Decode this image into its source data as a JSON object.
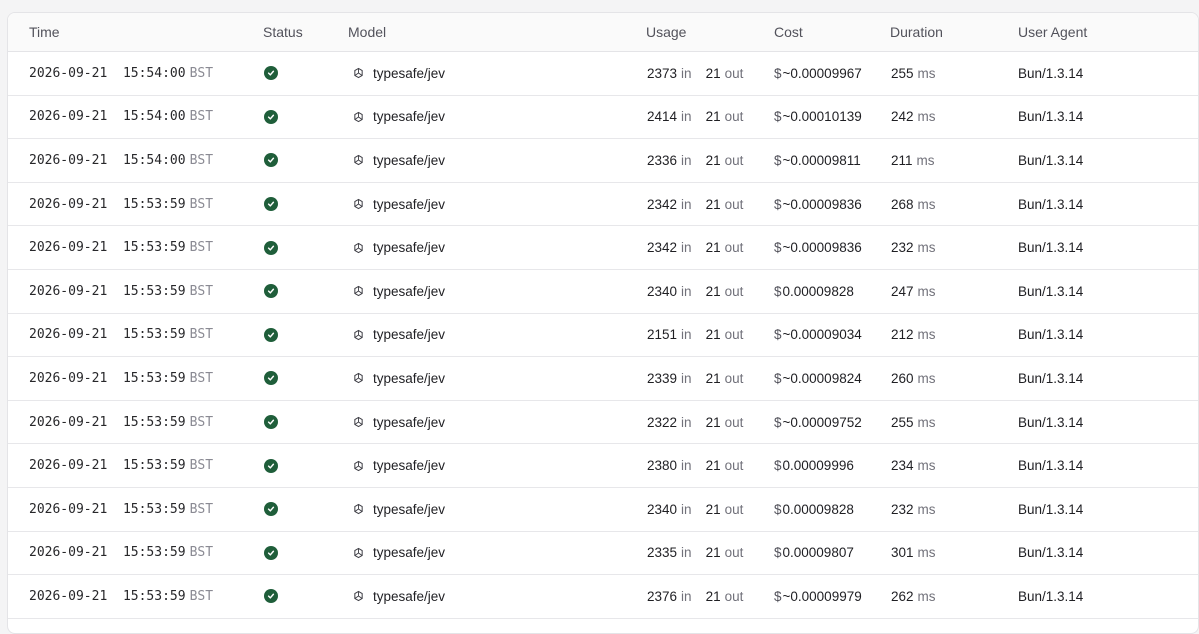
{
  "header": {
    "time": "Time",
    "status": "Status",
    "model": "Model",
    "usage": "Usage",
    "cost": "Cost",
    "duration": "Duration",
    "user_agent": "User Agent"
  },
  "labels": {
    "in": "in",
    "out": "out",
    "ms": "ms",
    "currency": "$"
  },
  "colors": {
    "status_ok": "#1f5e3a"
  },
  "rows": [
    {
      "date": "2026-09-21",
      "time": "15:54:00",
      "tz": "BST",
      "model": "typesafe/jev",
      "in": "2373",
      "out": "21",
      "cost": "~0.00009967",
      "duration": "255",
      "ua": "Bun/1.3.14"
    },
    {
      "date": "2026-09-21",
      "time": "15:54:00",
      "tz": "BST",
      "model": "typesafe/jev",
      "in": "2414",
      "out": "21",
      "cost": "~0.00010139",
      "duration": "242",
      "ua": "Bun/1.3.14"
    },
    {
      "date": "2026-09-21",
      "time": "15:54:00",
      "tz": "BST",
      "model": "typesafe/jev",
      "in": "2336",
      "out": "21",
      "cost": "~0.00009811",
      "duration": "211",
      "ua": "Bun/1.3.14"
    },
    {
      "date": "2026-09-21",
      "time": "15:53:59",
      "tz": "BST",
      "model": "typesafe/jev",
      "in": "2342",
      "out": "21",
      "cost": "~0.00009836",
      "duration": "268",
      "ua": "Bun/1.3.14"
    },
    {
      "date": "2026-09-21",
      "time": "15:53:59",
      "tz": "BST",
      "model": "typesafe/jev",
      "in": "2342",
      "out": "21",
      "cost": "~0.00009836",
      "duration": "232",
      "ua": "Bun/1.3.14"
    },
    {
      "date": "2026-09-21",
      "time": "15:53:59",
      "tz": "BST",
      "model": "typesafe/jev",
      "in": "2340",
      "out": "21",
      "cost": "0.00009828",
      "duration": "247",
      "ua": "Bun/1.3.14"
    },
    {
      "date": "2026-09-21",
      "time": "15:53:59",
      "tz": "BST",
      "model": "typesafe/jev",
      "in": "2151",
      "out": "21",
      "cost": "~0.00009034",
      "duration": "212",
      "ua": "Bun/1.3.14"
    },
    {
      "date": "2026-09-21",
      "time": "15:53:59",
      "tz": "BST",
      "model": "typesafe/jev",
      "in": "2339",
      "out": "21",
      "cost": "~0.00009824",
      "duration": "260",
      "ua": "Bun/1.3.14"
    },
    {
      "date": "2026-09-21",
      "time": "15:53:59",
      "tz": "BST",
      "model": "typesafe/jev",
      "in": "2322",
      "out": "21",
      "cost": "~0.00009752",
      "duration": "255",
      "ua": "Bun/1.3.14"
    },
    {
      "date": "2026-09-21",
      "time": "15:53:59",
      "tz": "BST",
      "model": "typesafe/jev",
      "in": "2380",
      "out": "21",
      "cost": "0.00009996",
      "duration": "234",
      "ua": "Bun/1.3.14"
    },
    {
      "date": "2026-09-21",
      "time": "15:53:59",
      "tz": "BST",
      "model": "typesafe/jev",
      "in": "2340",
      "out": "21",
      "cost": "0.00009828",
      "duration": "232",
      "ua": "Bun/1.3.14"
    },
    {
      "date": "2026-09-21",
      "time": "15:53:59",
      "tz": "BST",
      "model": "typesafe/jev",
      "in": "2335",
      "out": "21",
      "cost": "0.00009807",
      "duration": "301",
      "ua": "Bun/1.3.14"
    },
    {
      "date": "2026-09-21",
      "time": "15:53:59",
      "tz": "BST",
      "model": "typesafe/jev",
      "in": "2376",
      "out": "21",
      "cost": "~0.00009979",
      "duration": "262",
      "ua": "Bun/1.3.14"
    }
  ]
}
